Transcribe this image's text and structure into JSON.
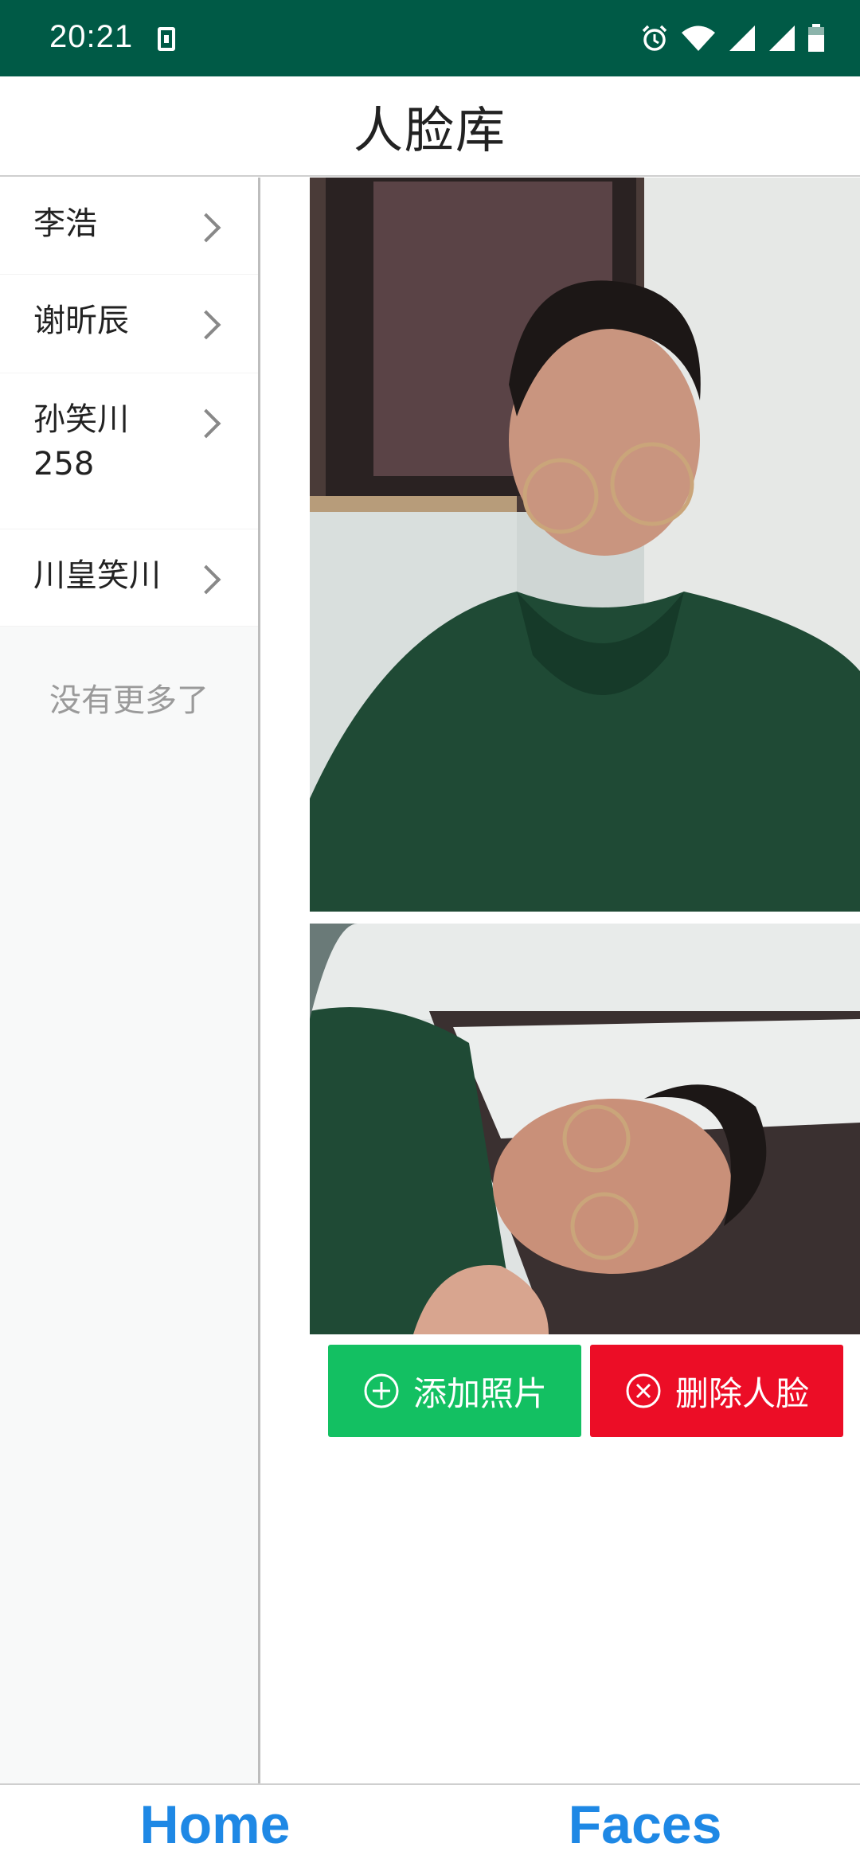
{
  "status_bar": {
    "time": "20:21",
    "icons": [
      "download-icon",
      "alarm-icon",
      "wifi-icon",
      "signal-icon",
      "signal-icon",
      "battery-icon"
    ]
  },
  "header": {
    "title": "人脸库"
  },
  "sidebar": {
    "items": [
      {
        "label": "李浩",
        "icon": "chevron-right-icon"
      },
      {
        "label": "谢昕辰",
        "icon": "chevron-right-icon"
      },
      {
        "label": "孙笑川258",
        "icon": "chevron-right-icon"
      },
      {
        "label": "川皇笑川",
        "icon": "chevron-right-icon"
      }
    ],
    "end_text": "没有更多了"
  },
  "main": {
    "actions": {
      "add_photo_label": "添加照片",
      "add_photo_icon": "plus-circle-icon",
      "delete_face_label": "删除人脸",
      "delete_face_icon": "x-circle-icon"
    }
  },
  "bottom_nav": {
    "home_label": "Home",
    "faces_label": "Faces"
  },
  "colors": {
    "status_bar": "#005a46",
    "add_button": "#13c062",
    "delete_button": "#ec0d26",
    "nav_text": "#1e88e5"
  }
}
